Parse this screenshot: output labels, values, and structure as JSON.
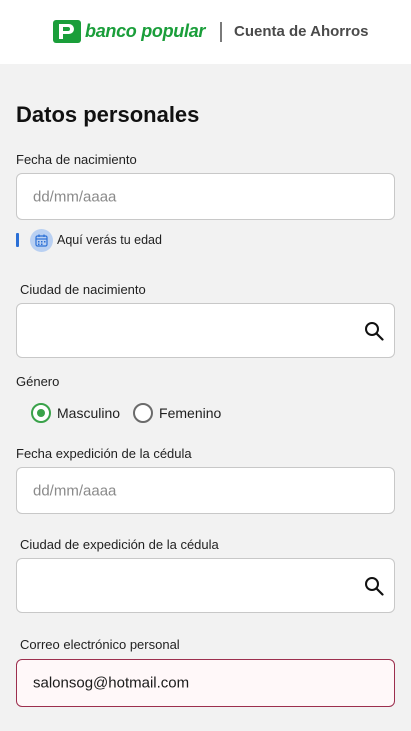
{
  "header": {
    "brand": "banco popular",
    "product": "Cuenta de Ahorros",
    "brand_color": "#1a9e3a"
  },
  "form": {
    "title": "Datos personales",
    "birth_date": {
      "label": "Fecha de nacimiento",
      "placeholder": "dd/mm/aaaa"
    },
    "age_hint": {
      "icon": "calendar-icon",
      "text": "Aquí verás tu edad"
    },
    "birth_city": {
      "label": "Ciudad de nacimiento",
      "icon": "search-icon",
      "value": ""
    },
    "gender": {
      "label": "Género",
      "options": [
        "Masculino",
        "Femenino"
      ],
      "selected": "Masculino"
    },
    "id_issue_date": {
      "label": "Fecha expedición de la cédula",
      "placeholder": "dd/mm/aaaa"
    },
    "id_issue_city": {
      "label": "Ciudad de expedición de la cédula",
      "icon": "search-icon",
      "value": ""
    },
    "email": {
      "label": "Correo electrónico personal",
      "value": "salonsog@hotmail.com",
      "state": "error"
    }
  },
  "colors": {
    "accent_green": "#3aa24a",
    "hint_blue": "#2b6fd6",
    "error_border": "#9c2f4e"
  }
}
